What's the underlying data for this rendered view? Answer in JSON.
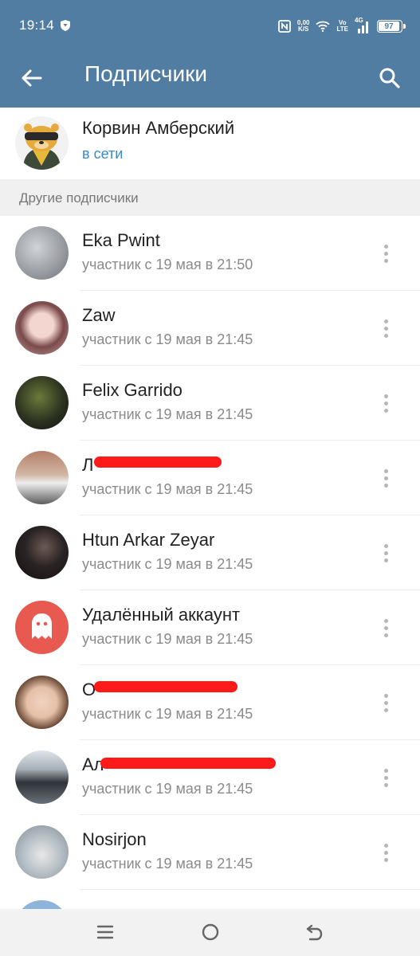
{
  "status_bar": {
    "time": "19:14",
    "speed_value": "0,00",
    "speed_unit": "K/S",
    "volte_top": "Vo",
    "volte_bottom": "LTE",
    "network": "4G",
    "battery": "97"
  },
  "app_bar": {
    "title": "Подписчики",
    "back_icon": "arrow-left-icon",
    "search_icon": "search-icon"
  },
  "owner": {
    "name": "Корвин Амберский",
    "status": "в сети",
    "avatar_icon": "cartoon-avatar"
  },
  "section": {
    "label": "Другие подписчики"
  },
  "members": [
    {
      "name": "Eka Pwint",
      "sub": "участник с 19 мая в 21:50",
      "avatar_color": "#9aa0a6"
    },
    {
      "name": "Zaw",
      "sub": "участник с 19 мая в 21:45",
      "avatar_color": "#c9a3a8"
    },
    {
      "name": "Felix Garrido",
      "sub": "участник с 19 мая в 21:45",
      "avatar_color": "#3e4a2a"
    },
    {
      "name": "Л",
      "sub": "участник с 19 мая в 21:45",
      "avatar_color": "#a88b7a"
    },
    {
      "name": "Htun Arkar Zeyar",
      "sub": "участник с 19 мая в 21:45",
      "avatar_color": "#2b2424"
    },
    {
      "name": "Удалённый аккаунт",
      "sub": "участник с 19 мая в 21:45",
      "avatar_color": "#e8594f"
    },
    {
      "name": "О",
      "sub": "участник с 19 мая в 21:45",
      "avatar_color": "#d9b8a3"
    },
    {
      "name": "Ал",
      "sub": "участник с 19 мая в 21:45",
      "avatar_color": "#4d5660"
    },
    {
      "name": "Nosirjon",
      "sub": "участник с 19 мая в 21:45",
      "avatar_color": "#9aa7ae"
    }
  ],
  "colors": {
    "header": "#517da2",
    "link": "#3a8acb",
    "secondary_text": "#8a8a8a",
    "section_bg": "#f0f0f0",
    "deleted_account": "#e8594f"
  },
  "nav_bar": {
    "menu_icon": "menu-icon",
    "home_icon": "home-circle-icon",
    "back_icon": "back-icon"
  }
}
